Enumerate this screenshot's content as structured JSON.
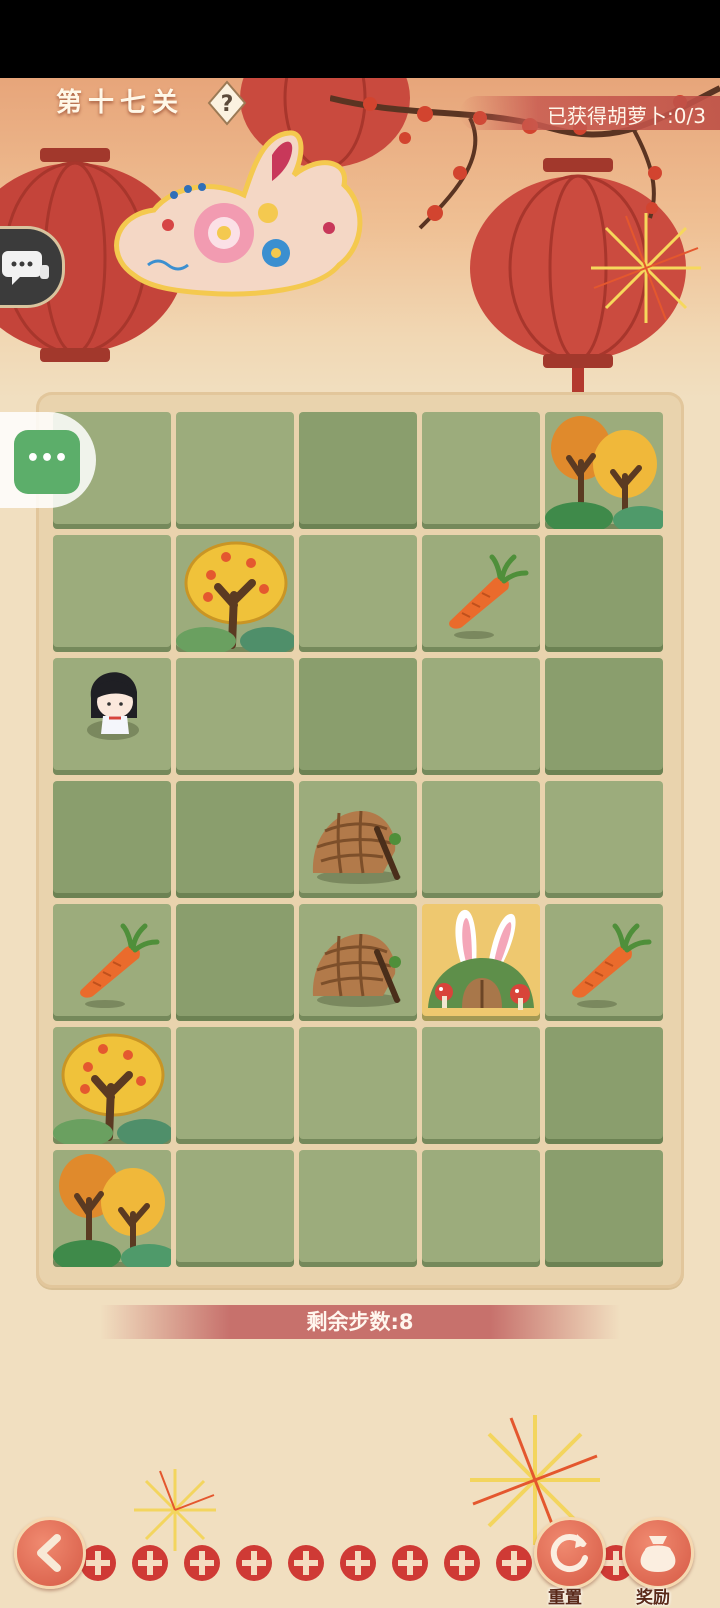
{
  "header": {
    "level_title": "第十七关",
    "carrot_progress": "已获得胡萝卜:0/3"
  },
  "board": {
    "columns": 5,
    "rows": 7,
    "cells": [
      [
        "empty",
        "empty",
        "empty",
        "empty",
        "autumn-trees"
      ],
      [
        "empty",
        "fruit-tree",
        "empty",
        "carrot",
        "empty"
      ],
      [
        "player",
        "empty",
        "empty",
        "empty",
        "empty"
      ],
      [
        "empty",
        "empty",
        "basket-trap",
        "empty",
        "empty"
      ],
      [
        "carrot",
        "empty",
        "basket-trap",
        "rabbit-burrow",
        "carrot"
      ],
      [
        "fruit-tree",
        "empty",
        "empty",
        "empty",
        "empty"
      ],
      [
        "autumn-trees",
        "empty",
        "empty",
        "empty",
        "empty"
      ]
    ]
  },
  "footer": {
    "steps_remaining": "剩余步数:8",
    "reset_label": "重置",
    "reward_label": "奖励"
  },
  "colors": {
    "tile_light": "#9cac7c",
    "tile_dark": "#8a9e6d",
    "burrow_tile": "#eec86f",
    "background": "#f1dfc0",
    "accent_red": "#c7716c"
  },
  "icons": [
    "help-icon",
    "chat-icon",
    "more-icon",
    "back-arrow-icon",
    "reset-icon",
    "reward-bag-icon",
    "rabbit-badge-icon"
  ]
}
